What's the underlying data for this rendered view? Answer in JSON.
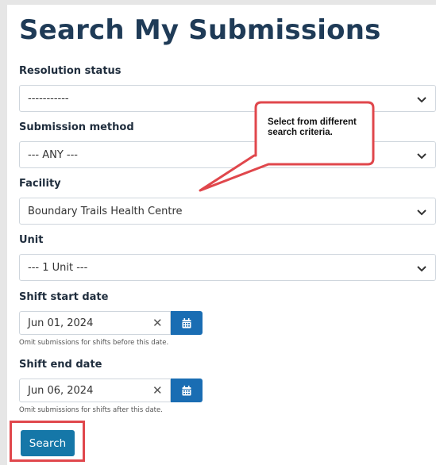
{
  "page": {
    "title": "Search My Submissions"
  },
  "fields": {
    "resolution_status": {
      "label": "Resolution status",
      "value": "-----------"
    },
    "submission_method": {
      "label": "Submission method",
      "value": "--- ANY ---"
    },
    "facility": {
      "label": "Facility",
      "value": "Boundary Trails Health Centre"
    },
    "unit": {
      "label": "Unit",
      "value": "--- 1 Unit ---"
    },
    "shift_start": {
      "label": "Shift start date",
      "value": "Jun 01, 2024",
      "hint": "Omit submissions for shifts before this date."
    },
    "shift_end": {
      "label": "Shift end date",
      "value": "Jun 06, 2024",
      "hint": "Omit submissions for shifts after this date."
    }
  },
  "actions": {
    "search_label": "Search"
  },
  "annotation": {
    "callout_text": "Select from different search criteria.",
    "highlight_color": "#e0474c"
  },
  "icons": {
    "dropdown": "chevron-down-icon",
    "clear": "close-icon",
    "calendar": "calendar-icon"
  },
  "colors": {
    "title": "#1f3b57",
    "primary_button": "#1577a8",
    "calendar_button": "#1a6db3",
    "background": "#e6e6e6"
  }
}
